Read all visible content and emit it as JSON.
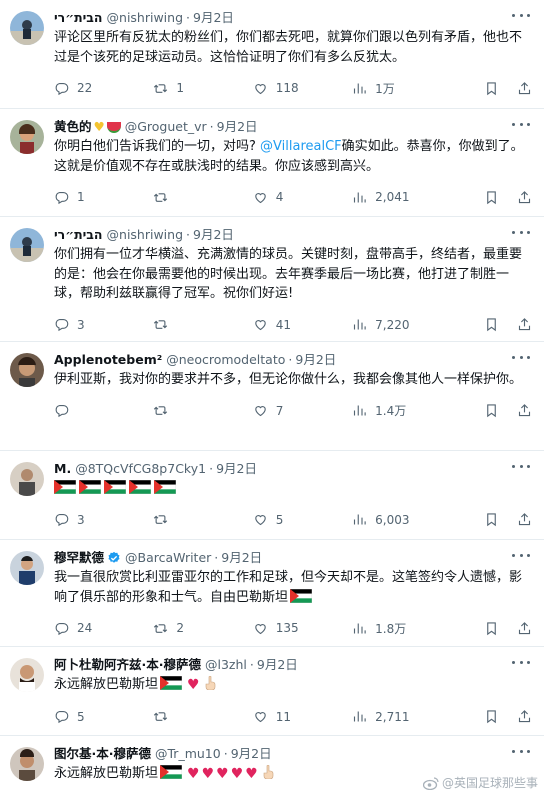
{
  "tweets": [
    {
      "name": "הבית״רי",
      "handle": "@nishriwing",
      "time": "9月2日",
      "text": "评论区里所有反犹太的粉丝们，你们都去死吧，就算你们跟以色列有矛盾，他也不过是个该死的足球运动员。这恰恰证明了你们有多么反犹太。",
      "replies": "22",
      "retweets": "1",
      "likes": "118",
      "views": "1万"
    },
    {
      "name": "黄色的",
      "handle": "@Groguet_vr",
      "time": "9月2日",
      "text_pre": "你明白他们告诉我们的一切，对吗? ",
      "mention": "@VillarealCF",
      "text_post": "确实如此。恭喜你，你做到了。这就是价值观不存在或肤浅时的结果。你应该感到高兴。",
      "replies": "1",
      "retweets": "",
      "likes": "4",
      "views": "2,041"
    },
    {
      "name": "הבית״רי",
      "handle": "@nishriwing",
      "time": "9月2日",
      "text": "你们拥有一位才华横溢、充满激情的球员。关键时刻，盘带高手，终结者，最重要的是：他会在你最需要他的时候出现。去年赛季最后一场比赛，他打进了制胜一球，帮助利兹联赢得了冠军。祝你们好运!",
      "replies": "3",
      "retweets": "",
      "likes": "41",
      "views": "7,220"
    },
    {
      "name": "Applenotebem²",
      "handle": "@neocromodeltato",
      "time": "9月2日",
      "text": "伊利亚斯，我对你的要求并不多，但无论你做什么，我都会像其他人一样保护你。",
      "replies": "",
      "retweets": "",
      "likes": "7",
      "views": "1.4万"
    },
    {
      "name": "M.",
      "handle": "@8TQcVfCG8p7Cky1",
      "time": "9月2日",
      "replies": "3",
      "retweets": "",
      "likes": "5",
      "views": "6,003"
    },
    {
      "name": "穆罕默德",
      "handle": "@BarcaWriter",
      "time": "9月2日",
      "text": "我一直很欣赏比利亚雷亚尔的工作和足球，但今天却不是。这笔签约令人遗憾，影响了俱乐部的形象和士气。自由巴勒斯坦",
      "replies": "24",
      "retweets": "2",
      "likes": "135",
      "views": "1.8万"
    },
    {
      "name": "阿卜杜勒阿齐兹·本·穆萨德",
      "handle": "@l3zhl",
      "time": "9月2日",
      "text": "永远解放巴勒斯坦",
      "replies": "5",
      "retweets": "",
      "likes": "11",
      "views": "2,711"
    },
    {
      "name": "图尔基·本·穆萨德",
      "handle": "@Tr_mu10",
      "time": "9月2日",
      "text": "永远解放巴勒斯坦"
    }
  ],
  "sep": "·",
  "watermark": "@英国足球那些事",
  "colors": {
    "text": "#0f1419",
    "secondary": "#536471",
    "link": "#1d9bf0",
    "verified": "#1d9bf0",
    "heart": "#e0245e",
    "border": "#e6ecf0"
  },
  "icons": [
    "more-icon",
    "reply-icon",
    "retweet-icon",
    "like-icon",
    "views-icon",
    "bookmark-icon",
    "share-icon",
    "verified-badge-icon",
    "palestine-flag-icon",
    "red-heart-icon",
    "pointing-finger-icon",
    "weibo-logo-icon"
  ]
}
